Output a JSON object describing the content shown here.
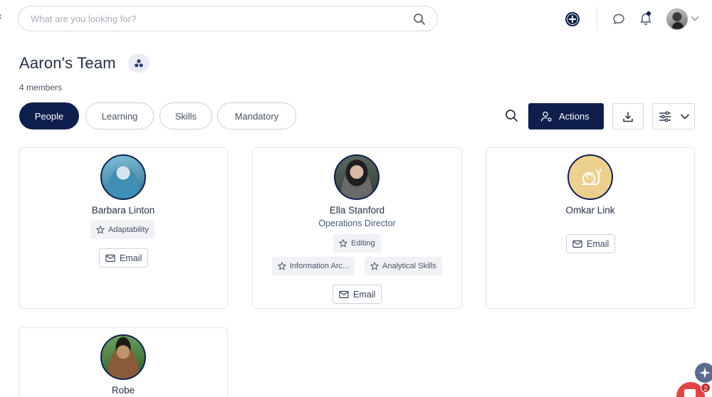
{
  "search": {
    "placeholder": "What are you looking for?"
  },
  "header": {
    "title": "Aaron's Team",
    "members": "4 members"
  },
  "tabs": [
    {
      "label": "People",
      "active": true
    },
    {
      "label": "Learning",
      "active": false
    },
    {
      "label": "Skills",
      "active": false
    },
    {
      "label": "Mandatory",
      "active": false
    }
  ],
  "toolbar": {
    "actions_label": "Actions"
  },
  "colors": {
    "primary": "#0f1f4d",
    "placeholder_avatar_bg": "#edd08f",
    "notification": "#e04545"
  },
  "people": [
    {
      "name": "Barbara Linton",
      "role": "",
      "skills": [
        "Adaptability"
      ],
      "email_label": "Email"
    },
    {
      "name": "Ella Stanford",
      "role": "Operations Director",
      "skills": [
        "Editing",
        "Information Arc...",
        "Analytical Skills"
      ],
      "email_label": "Email"
    },
    {
      "name": "Omkar Link",
      "role": "",
      "skills": [],
      "email_label": "Email"
    },
    {
      "name": "Robe",
      "role": "",
      "skills": [],
      "email_label": ""
    }
  ],
  "widgets": {
    "chat_count": "2"
  }
}
